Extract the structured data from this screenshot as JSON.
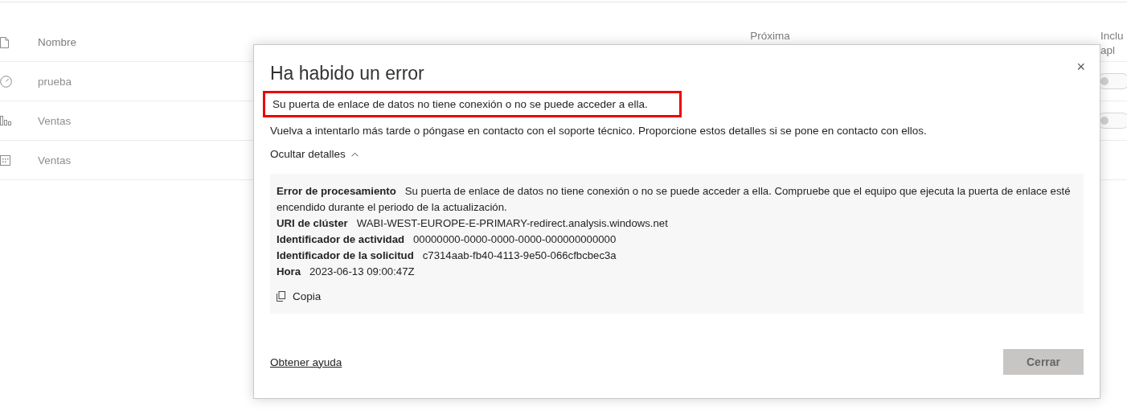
{
  "table": {
    "columns": [
      {
        "kind": "name",
        "lines": [
          "Nombre"
        ]
      },
      {
        "kind": "next",
        "lines": [
          "Próxima"
        ]
      },
      {
        "kind": "include",
        "lines": [
          "Inclu",
          "apl"
        ]
      }
    ],
    "rows": [
      {
        "kind": "dashboard",
        "name": "prueba",
        "include_in_app": false
      },
      {
        "kind": "report",
        "name": "Ventas",
        "include_in_app": false
      },
      {
        "kind": "dataset",
        "name": "Ventas"
      }
    ]
  },
  "dialog": {
    "title": "Ha habido un error",
    "close": "×",
    "message": {
      "text": "Su puerta de enlace de datos no tiene conexión o no se puede acceder a ella.",
      "highlighted": true
    },
    "hint": "Vuelva a intentarlo más tarde o póngase en contacto con el soporte técnico. Proporcione estos detalles si se pone en contacto con ellos.",
    "details_toggle": {
      "label": "Ocultar detalles",
      "expanded": true
    },
    "details": [
      {
        "label": "Error de procesamiento",
        "value": "Su puerta de enlace de datos no tiene conexión o no se puede acceder a ella. Compruebe que el equipo que ejecuta la puerta de enlace esté encendido durante el periodo de la actualización."
      },
      {
        "label": "URI de clúster",
        "value": "WABI-WEST-EUROPE-E-PRIMARY-redirect.analysis.windows.net"
      },
      {
        "label": "Identificador de actividad",
        "value": "00000000-0000-0000-0000-000000000000"
      },
      {
        "label": "Identificador de la solicitud",
        "value": "c7314aab-fb40-4113-9e50-066cfbcbec3a"
      },
      {
        "label": "Hora",
        "value": "2023-06-13 09:00:47Z"
      }
    ],
    "copy": "Copia",
    "help_link": "Obtener ayuda",
    "close_button": "Cerrar"
  }
}
